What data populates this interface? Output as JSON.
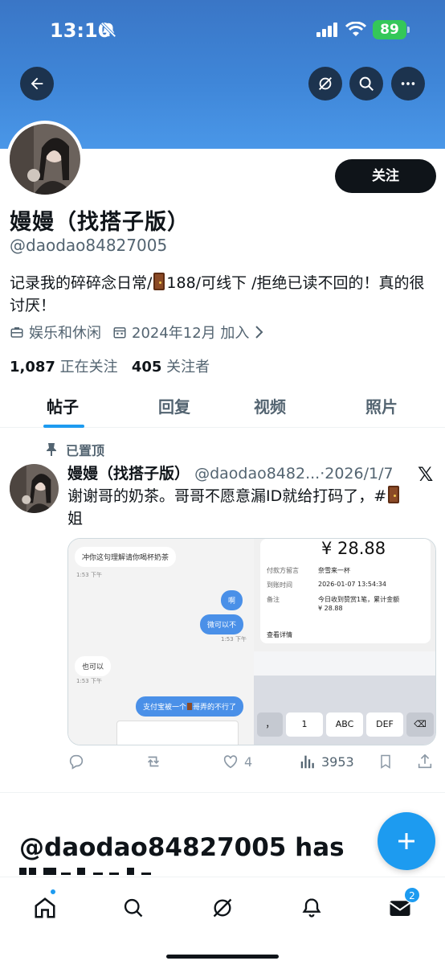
{
  "status_bar": {
    "time": "13:10",
    "battery": "89"
  },
  "profile": {
    "follow_label": "关注",
    "display_name": "嫚嫚（找搭子版）",
    "handle": "@daodao84827005",
    "bio_part1": "记录我的碎碎念日常/",
    "bio_part2": "188/可线下 /拒绝已读不回的！真的很讨厌！",
    "category": "娱乐和休闲",
    "joined": "2024年12月 加入",
    "following_count": "1,087",
    "following_label": "正在关注",
    "followers_count": "405",
    "followers_label": "关注者"
  },
  "tabs": [
    {
      "label": "帖子"
    },
    {
      "label": "回复"
    },
    {
      "label": "视频"
    },
    {
      "label": "照片"
    }
  ],
  "post": {
    "pinned_label": "已置顶",
    "name": "嫚嫚（找搭子版）",
    "handle": "@daodao8482...",
    "date": "·2026/1/7",
    "text_part1": "谢谢哥的奶茶。哥哥不愿意漏ID就给打码了，#",
    "text_part2": "姐",
    "like_count": "4",
    "view_count": "3953",
    "media": {
      "chat": [
        {
          "text": "冲你这句理解请你喝杯奶茶",
          "side": "in"
        },
        {
          "text": "1:53 下午",
          "side": "ts"
        },
        {
          "text": "啊",
          "side": "out"
        },
        {
          "text": "微可以不",
          "side": "out"
        },
        {
          "text": "1:53 下午",
          "side": "ts"
        },
        {
          "text": "也可以",
          "side": "in"
        },
        {
          "text": "1:53 下午",
          "side": "ts"
        },
        {
          "text": "支付宝被一个",
          "side": "out"
        },
        {
          "text": "哥弄的不行了",
          "side": "out"
        }
      ],
      "amount": "¥ 28.88",
      "rows": [
        {
          "label": "付款方留言",
          "value": "奈雪来一杯"
        },
        {
          "label": "到账时间",
          "value": "2026-01-07 13:54:34"
        },
        {
          "label": "备注",
          "value": "今日收到赞赏1笔，累计金额"
        },
        {
          "label": "",
          "value": "¥ 28.88"
        }
      ],
      "details_label": "查看详情",
      "keys": [
        "，",
        "1",
        "ABC",
        "DEF"
      ]
    }
  },
  "blocked": {
    "title": "@daodao84827005 has"
  },
  "nav": {
    "mail_badge": "2"
  },
  "colors": {
    "accent": "#1d9bf0",
    "banner": "#3f86d8"
  }
}
